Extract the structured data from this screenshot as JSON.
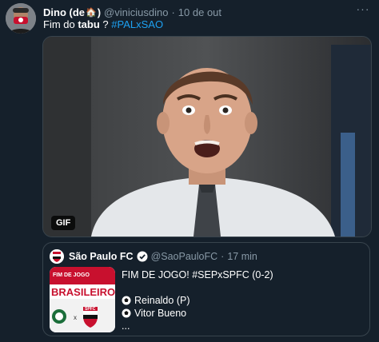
{
  "author": {
    "name": "Dino (de",
    "name_close": ")",
    "handle": "@viniciusdino",
    "separator": "·",
    "date": "10 de out"
  },
  "tweet": {
    "text_start": "Fim do ",
    "text_bold": "tabu",
    "text_mid": " ? ",
    "hashtag": "#PALxSAO"
  },
  "media": {
    "badge": "GIF"
  },
  "quoted": {
    "name": "São Paulo FC",
    "handle": "@SaoPauloFC",
    "separator": "·",
    "time": "17 min",
    "line1": "FIM DE JOGO! #SEPxSPFC (0-2)",
    "goal1": "Reinaldo (P)",
    "goal2": "Vitor Bueno",
    "ellipsis": "...",
    "thumb_banner": "BRASILEIRO",
    "thumb_small": "FIM DE JOGO",
    "thumb_team": "SPFC",
    "thumb_vs": "x"
  },
  "colors": {
    "background": "#15202b",
    "accent": "#1da1f2",
    "muted": "#8899a6",
    "border": "#38444d"
  }
}
